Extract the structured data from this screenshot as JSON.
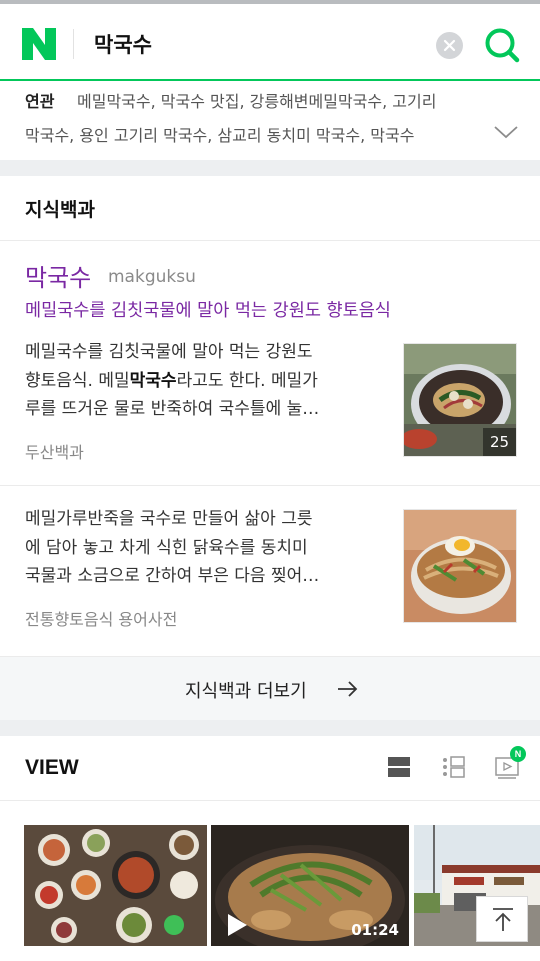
{
  "search": {
    "query": "막국수",
    "logo_letter": "N",
    "clear_icon": "clear-x-icon",
    "search_icon": "search-magnifier-icon"
  },
  "related": {
    "label": "연관",
    "line1": "메밀막국수, 막국수 맛집, 강릉해변메밀막국수, 고기리",
    "line2": "막국수, 용인 고기리 막국수, 삼교리 동치미 막국수, 막국수",
    "expand_icon": "chevron-down-icon"
  },
  "encyclopedia": {
    "section_title": "지식백과",
    "entry": {
      "title": "막국수",
      "romanized": "makguksu",
      "subtitle": "메밀국수를 김칫국물에 말아 먹는 강원도 향토음식",
      "desc_line1": "메밀국수를 김칫국물에 말아 먹는 강원도",
      "desc_line2_pre": "향토음식. 메밀",
      "desc_line2_bold": "막국수",
      "desc_line2_post": "라고도 한다. 메밀가",
      "desc_line3": "루를 뜨거운 물로 반죽하여 국수틀에 눌…",
      "source": "두산백과",
      "image_count": "25"
    },
    "entry2": {
      "desc_line1": "메밀가루반죽을 국수로 만들어 삶아 그릇",
      "desc_line2": "에 담아 놓고 차게 식힌 닭육수를 동치미",
      "desc_line3": "국물과 소금으로 간하여 부은 다음 찢어…",
      "source": "전통향토음식 용어사전"
    },
    "more_label": "지식백과 더보기",
    "more_icon": "arrow-right-icon"
  },
  "view": {
    "title": "VIEW",
    "badge": "N",
    "icons": [
      "list-view-icon",
      "card-view-icon",
      "video-view-icon"
    ],
    "videos": [
      {
        "duration": ""
      },
      {
        "duration": "01:24"
      },
      {
        "duration": ""
      }
    ],
    "top_icon": "scroll-to-top-icon"
  },
  "colors": {
    "brand_green": "#03c75a",
    "encyclopedia_purple": "#7a28a3",
    "gap_gray": "#edeff1"
  }
}
